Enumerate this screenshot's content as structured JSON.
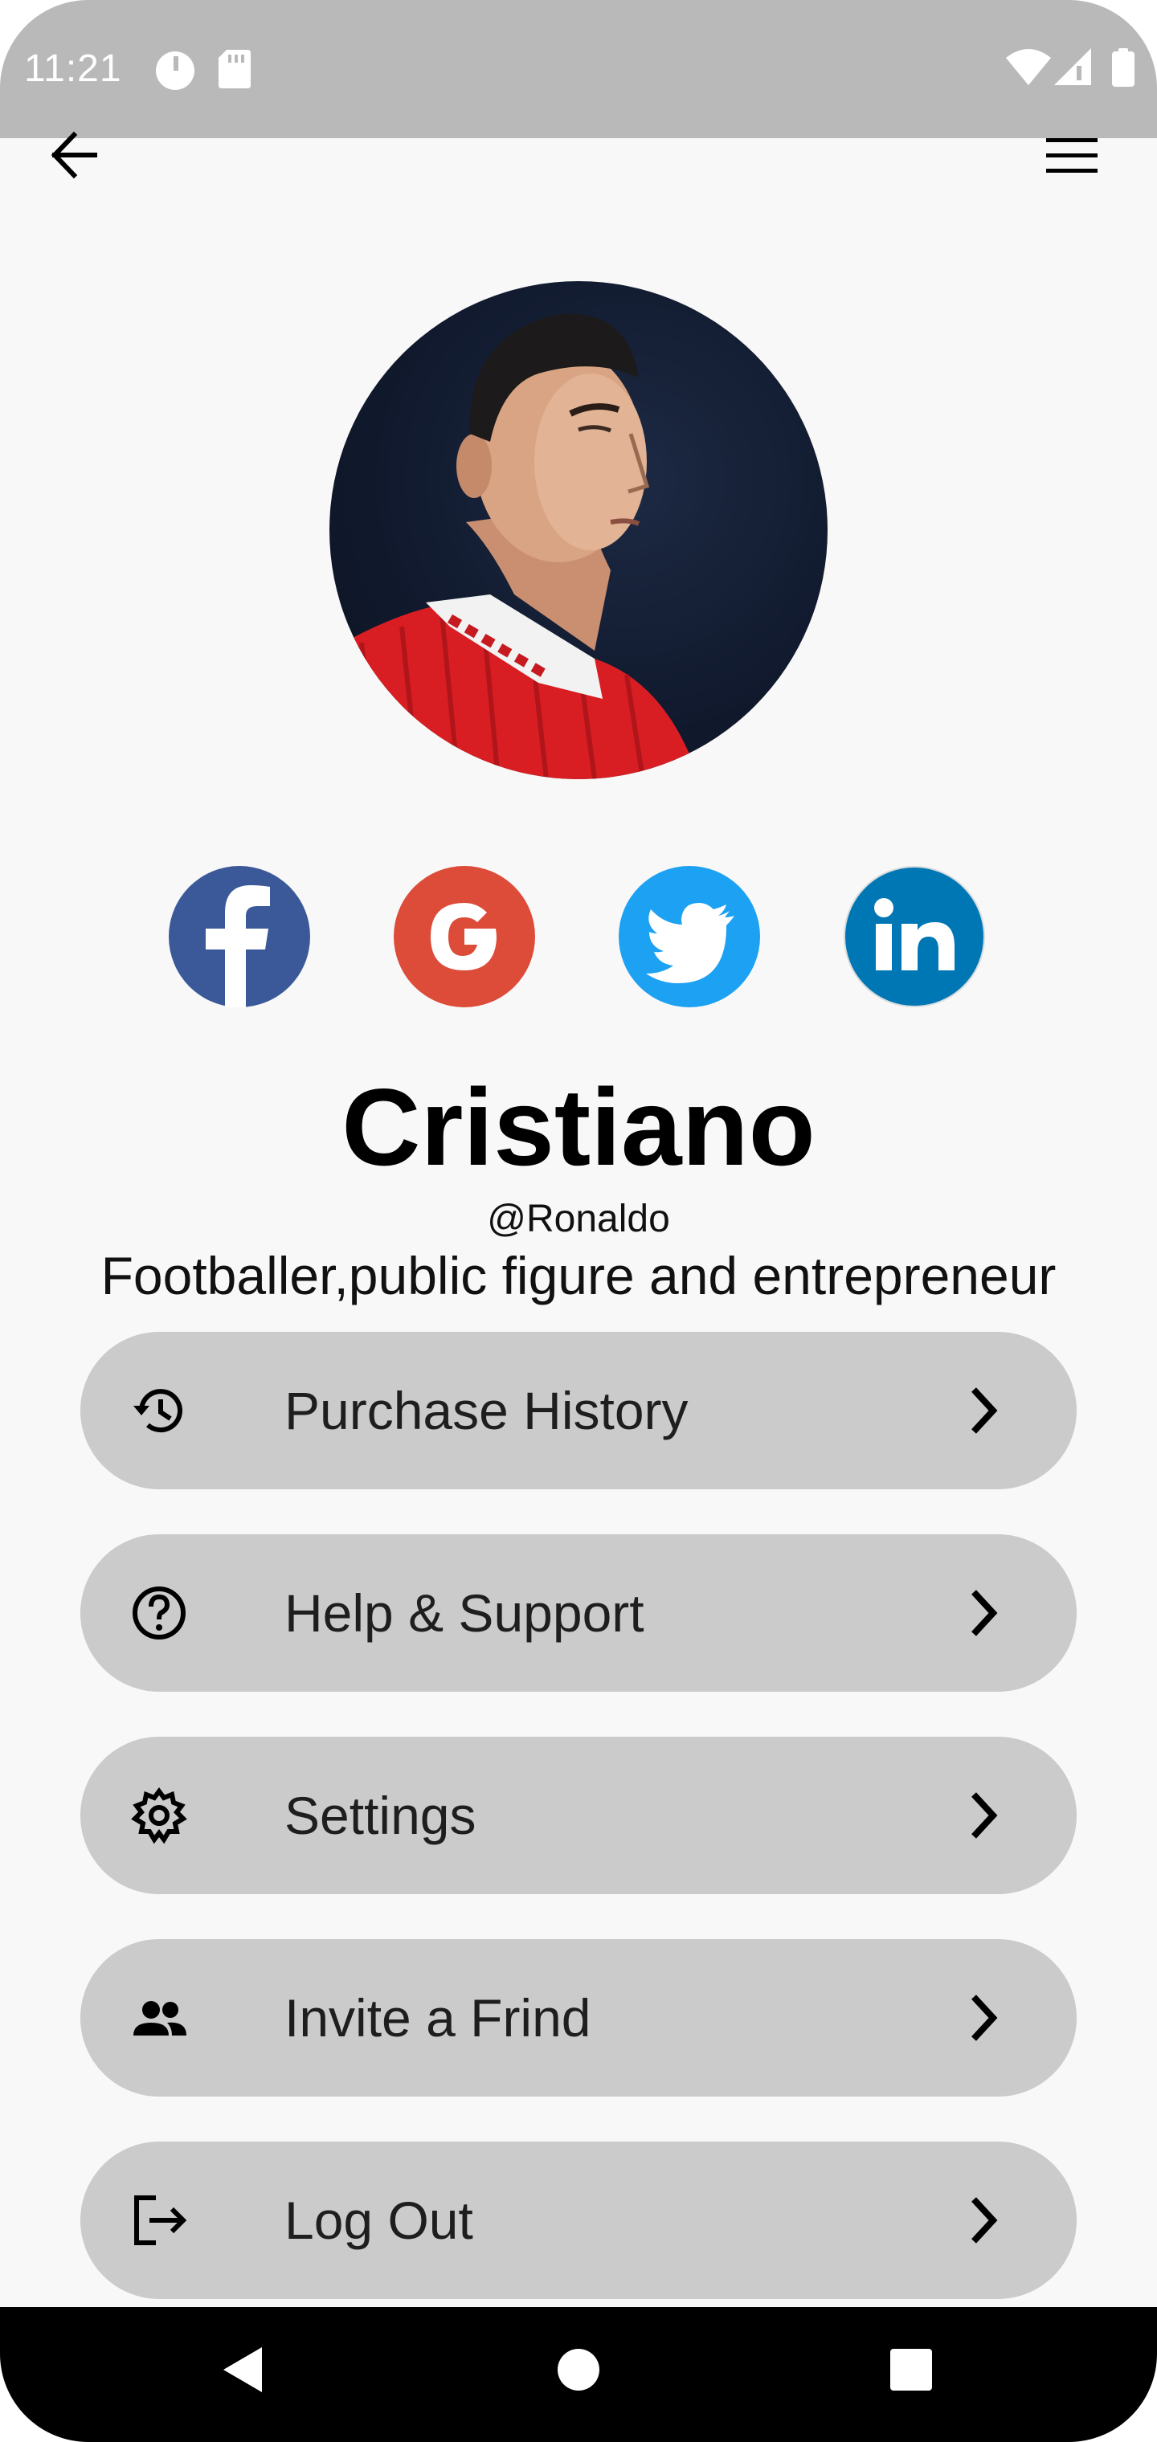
{
  "status_bar": {
    "time": "11:21",
    "left_icons": [
      "notification-icon",
      "sd-card-icon"
    ],
    "right_icons": [
      "wifi-icon",
      "signal-icon",
      "battery-icon"
    ]
  },
  "app_bar": {
    "back_icon": "arrow-left-icon",
    "menu_icon": "hamburger-menu-icon"
  },
  "profile": {
    "avatar": "profile-photo",
    "name": "Cristiano",
    "handle": "@Ronaldo",
    "bio": "Footballer,public figure and entrepreneur"
  },
  "social_links": [
    {
      "name": "facebook",
      "icon": "facebook-icon",
      "color": "#3b5998"
    },
    {
      "name": "google",
      "icon": "google-icon",
      "color": "#dd4b39"
    },
    {
      "name": "twitter",
      "icon": "twitter-icon",
      "color": "#1da1f2"
    },
    {
      "name": "linkedin",
      "icon": "linkedin-icon",
      "color": "#0077b5"
    }
  ],
  "menu": {
    "items": [
      {
        "label": "Purchase History",
        "icon": "history-icon"
      },
      {
        "label": "Help & Support",
        "icon": "help-icon"
      },
      {
        "label": "Settings",
        "icon": "settings-gear-icon"
      },
      {
        "label": "Invite a Frind",
        "icon": "people-icon"
      },
      {
        "label": "Log Out",
        "icon": "logout-icon"
      }
    ]
  },
  "colors": {
    "status_bar": "#b9b9b9",
    "background": "#f8f8f8",
    "menu_item_bg": "#cbcbcb",
    "nav_bar": "#000000"
  },
  "nav_bar": {
    "buttons": [
      "back-triangle-icon",
      "home-circle-icon",
      "recents-square-icon"
    ]
  }
}
